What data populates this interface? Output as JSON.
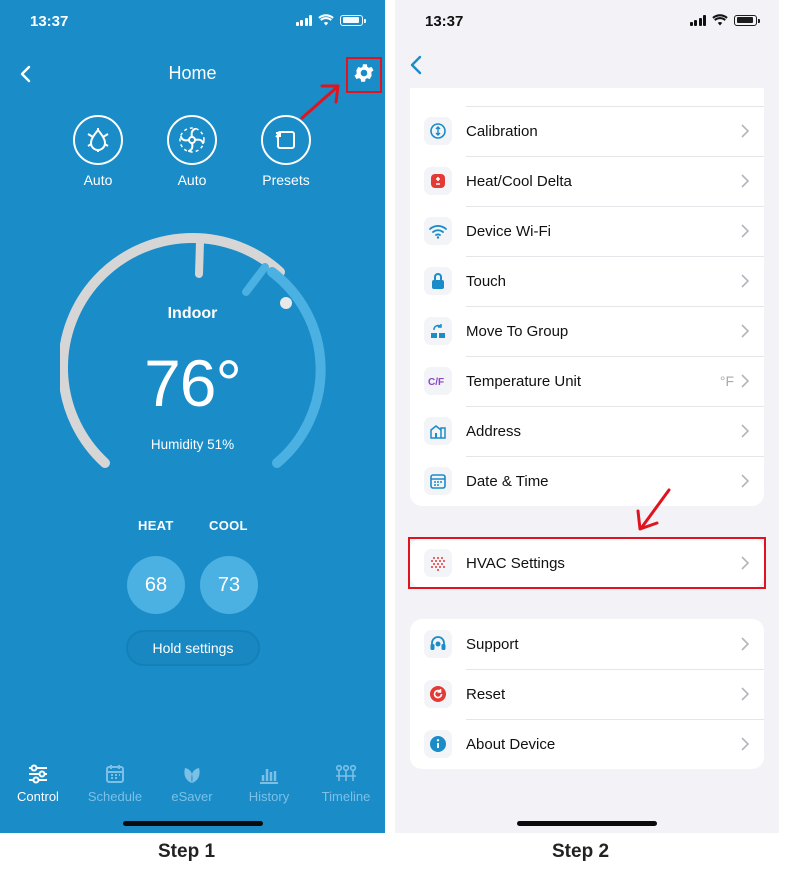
{
  "step1": {
    "status_bar": {
      "time": "13:37"
    },
    "header": {
      "title": "Home"
    },
    "modes": [
      {
        "label": "Auto",
        "icon": "snowflake-flame-icon"
      },
      {
        "label": "Auto",
        "icon": "fan-icon"
      },
      {
        "label": "Presets",
        "icon": "presets-icon"
      }
    ],
    "dial": {
      "label": "Indoor",
      "temperature": "76°",
      "humidity": "Humidity 51%"
    },
    "setpoints": {
      "heat_label": "HEAT",
      "cool_label": "COOL",
      "heat_value": "68",
      "cool_value": "73"
    },
    "hold_button": "Hold settings",
    "tabs": [
      {
        "label": "Control",
        "icon": "sliders-icon",
        "active": true
      },
      {
        "label": "Schedule",
        "icon": "calendar-icon",
        "active": false
      },
      {
        "label": "eSaver",
        "icon": "leaf-icon",
        "active": false
      },
      {
        "label": "History",
        "icon": "bar-chart-icon",
        "active": false
      },
      {
        "label": "Timeline",
        "icon": "timeline-icon",
        "active": false
      }
    ],
    "caption": "Step 1"
  },
  "step2": {
    "status_bar": {
      "time": "13:37"
    },
    "group1": [
      {
        "label": "Calibration",
        "icon": "calibration-icon"
      },
      {
        "label": "Heat/Cool Delta",
        "icon": "delta-icon"
      },
      {
        "label": "Device Wi-Fi",
        "icon": "wifi-icon"
      },
      {
        "label": "Touch",
        "icon": "lock-icon"
      },
      {
        "label": "Move To Group",
        "icon": "group-icon"
      },
      {
        "label": "Temperature Unit",
        "icon": "cf-icon",
        "value": "°F"
      },
      {
        "label": "Address",
        "icon": "building-icon"
      },
      {
        "label": "Date & Time",
        "icon": "calendar-icon"
      }
    ],
    "hvac": {
      "label": "HVAC Settings",
      "icon": "hvac-icon"
    },
    "group3": [
      {
        "label": "Support",
        "icon": "headset-icon"
      },
      {
        "label": "Reset",
        "icon": "reset-icon"
      },
      {
        "label": "About Device",
        "icon": "info-icon"
      }
    ],
    "caption": "Step 2"
  },
  "colors": {
    "primary_blue": "#1a8cc8",
    "highlight_red": "#e0141e"
  }
}
